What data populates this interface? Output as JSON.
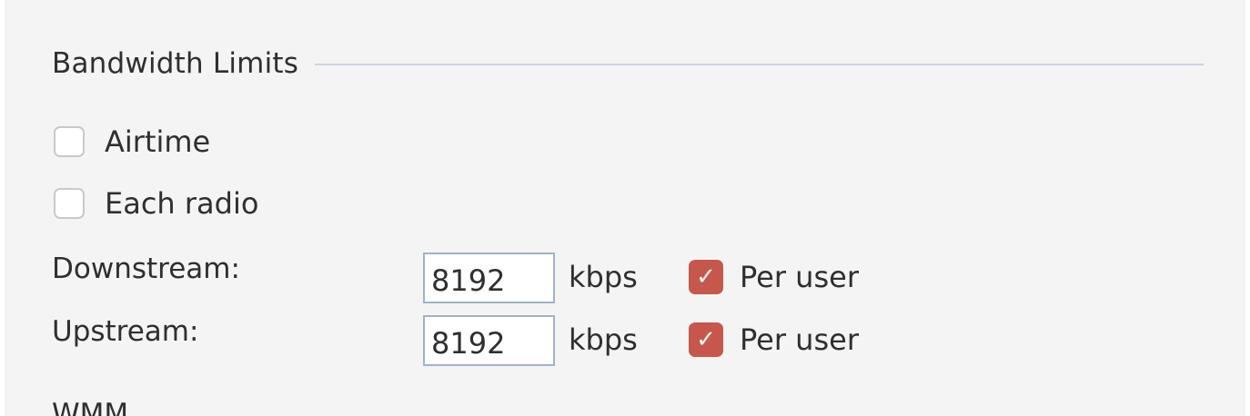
{
  "bandwidth_limits": {
    "title": "Bandwidth Limits",
    "airtime_label": "Airtime",
    "airtime_checked": false,
    "each_radio_label": "Each radio",
    "each_radio_checked": false,
    "downstream": {
      "label": "Downstream:",
      "value": "8192",
      "unit": "kbps",
      "per_user_label": "Per user",
      "per_user_checked": true
    },
    "upstream": {
      "label": "Upstream:",
      "value": "8192",
      "unit": "kbps",
      "per_user_label": "Per user",
      "per_user_checked": true
    }
  },
  "next_section": {
    "title": "WMM"
  },
  "colors": {
    "checkbox_checked": "#c8574b",
    "input_border": "#9fb3c8",
    "panel_background": "#f4f4f4"
  }
}
